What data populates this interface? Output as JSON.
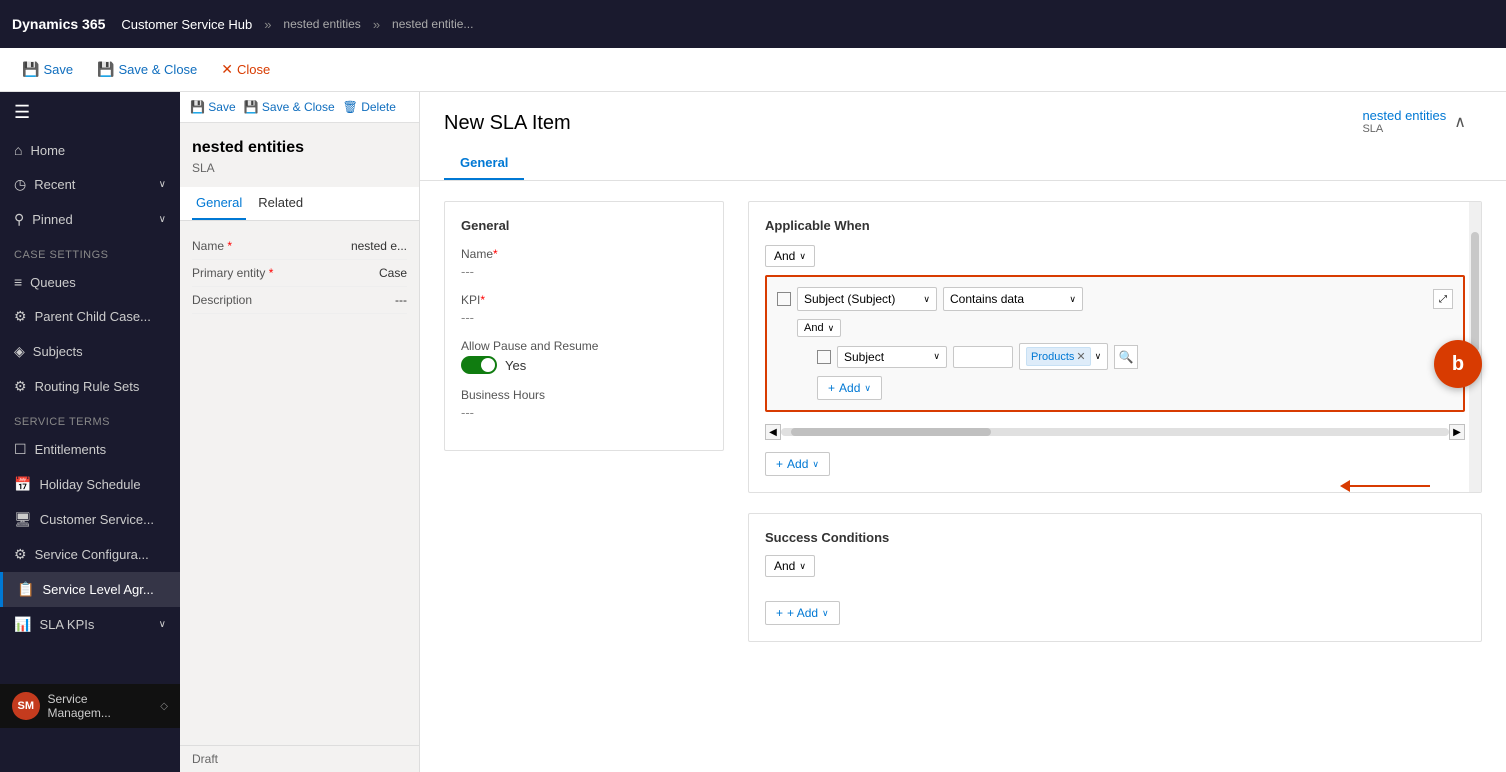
{
  "topNav": {
    "logo": "Dynamics 365",
    "app": "Customer Service Hub",
    "breadcrumb1": "nested entities",
    "breadcrumb2": "nested entitie...",
    "chevron": "»"
  },
  "subNav": {
    "save": "Save",
    "saveClose": "Save & Close",
    "close": "Close"
  },
  "sidebar": {
    "hamburger": "☰",
    "items": [
      {
        "id": "home",
        "icon": "⌂",
        "label": "Home",
        "hasChevron": false
      },
      {
        "id": "recent",
        "icon": "◷",
        "label": "Recent",
        "hasChevron": true
      },
      {
        "id": "pinned",
        "icon": "⚲",
        "label": "Pinned",
        "hasChevron": true
      }
    ],
    "sections": [
      {
        "title": "Case Settings",
        "items": [
          {
            "id": "queues",
            "icon": "☰",
            "label": "Queues"
          },
          {
            "id": "parent-child",
            "icon": "⚙",
            "label": "Parent Child Case..."
          },
          {
            "id": "subjects",
            "icon": "◈",
            "label": "Subjects"
          },
          {
            "id": "routing-rule-sets",
            "icon": "⚙",
            "label": "Routing Rule Sets"
          }
        ]
      },
      {
        "title": "Service Terms",
        "items": [
          {
            "id": "entitlements",
            "icon": "☐",
            "label": "Entitlements"
          },
          {
            "id": "holiday-schedule",
            "icon": "📅",
            "label": "Holiday Schedule"
          },
          {
            "id": "customer-service",
            "icon": "🖥",
            "label": "Customer Service..."
          },
          {
            "id": "service-configura",
            "icon": "⚙",
            "label": "Service Configura..."
          },
          {
            "id": "service-level-agr",
            "icon": "📋",
            "label": "Service Level Agr...",
            "active": true
          },
          {
            "id": "sla-kpis",
            "icon": "📊",
            "label": "SLA KPIs"
          }
        ]
      }
    ],
    "footer": {
      "icon": "SM",
      "label": "Service Managem...",
      "status": "Draft"
    }
  },
  "middlePanel": {
    "subnav": {
      "save": "Save",
      "saveClose": "Save & Close",
      "delete": "Delete"
    },
    "title": "nested entities",
    "subtitle": "SLA",
    "tabs": [
      "General",
      "Related"
    ],
    "fields": [
      {
        "label": "Name",
        "required": true,
        "value": "nested e..."
      },
      {
        "label": "Primary entity",
        "required": true,
        "value": "Case"
      },
      {
        "label": "Description",
        "required": false,
        "value": "---"
      }
    ]
  },
  "mainHeader": {
    "title": "New SLA Item",
    "tabs": [
      "General"
    ],
    "breadcrumbRight": {
      "link": "nested entities",
      "sub": "SLA",
      "collapseIcon": "∧"
    }
  },
  "generalCard": {
    "title": "General",
    "fields": [
      {
        "label": "Name",
        "required": true,
        "value": "---"
      },
      {
        "label": "KPI",
        "required": true,
        "value": "---"
      },
      {
        "label": "Allow Pause and Resume",
        "value": ""
      },
      {
        "label": "Business Hours",
        "value": "---"
      }
    ],
    "toggle": {
      "value": true,
      "label": "Yes"
    }
  },
  "applicableWhen": {
    "title": "Applicable When",
    "andLabel": "And",
    "outerCondition": {
      "field": "Subject (Subject)",
      "operator": "Contains data",
      "expandIcon": "⤢"
    },
    "innerAnd": "And",
    "innerCondition": {
      "field": "Subject",
      "inputValue": "",
      "tag": "Products",
      "searchIcon": "🔍"
    },
    "addInner": "+ Add",
    "addOuter": "+ Add"
  },
  "successConditions": {
    "title": "Success Conditions",
    "andLabel": "And",
    "addLabel": "+ Add"
  },
  "orangeButton": {
    "label": "b"
  }
}
